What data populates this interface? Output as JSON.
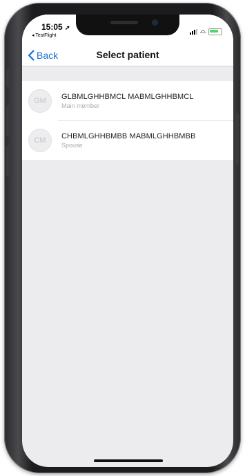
{
  "status_bar": {
    "time": "15:05",
    "location_arrow": "➚",
    "back_app": "◂ TestFlight",
    "icons": [
      "signal-icon",
      "wifi-icon",
      "battery-icon"
    ],
    "battery_color": "#4cd964"
  },
  "nav": {
    "back_label": "Back",
    "title": "Select patient",
    "accent": "#1a6fd6"
  },
  "patients": [
    {
      "initials": "GM",
      "name": "GLBMLGHHBMCL MABMLGHHBMCL",
      "relation": "Main member"
    },
    {
      "initials": "CM",
      "name": "CHBMLGHHBMBB MABMLGHHBMBB",
      "relation": "Spouse"
    }
  ]
}
